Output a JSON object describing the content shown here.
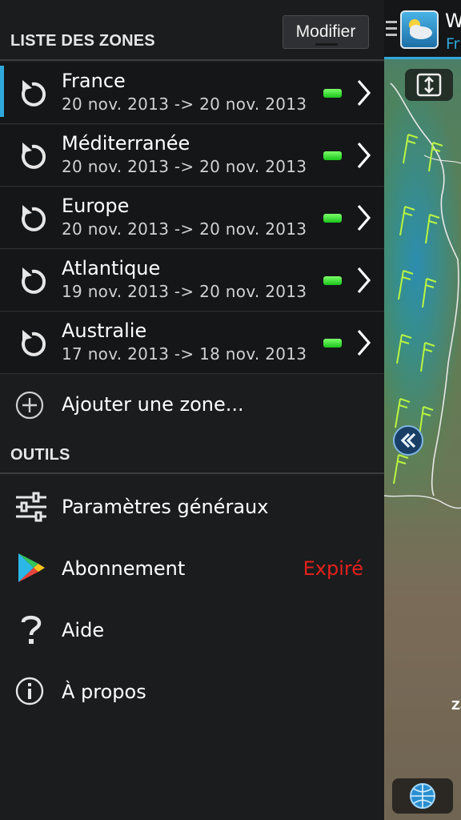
{
  "header": {
    "zones_title": "LISTE DES ZONES",
    "edit_label": "Modifier",
    "app_title_fragment": "W",
    "app_subtitle_fragment": "Fr"
  },
  "zones": [
    {
      "name": "France",
      "dates": "20 nov. 2013 -> 20 nov. 2013",
      "active": true,
      "status": "up-to-date"
    },
    {
      "name": "Méditerranée",
      "dates": "20 nov. 2013 -> 20 nov. 2013",
      "active": false,
      "status": "up-to-date"
    },
    {
      "name": "Europe",
      "dates": "20 nov. 2013 -> 20 nov. 2013",
      "active": false,
      "status": "up-to-date"
    },
    {
      "name": "Atlantique",
      "dates": "19 nov. 2013 -> 20 nov. 2013",
      "active": false,
      "status": "up-to-date"
    },
    {
      "name": "Australie",
      "dates": "17 nov. 2013 -> 18 nov. 2013",
      "active": false,
      "status": "up-to-date"
    }
  ],
  "add_zone_label": "Ajouter une zone...",
  "tools": {
    "title": "OUTILS",
    "items": [
      {
        "label": "Paramètres généraux",
        "icon": "sliders-icon"
      },
      {
        "label": "Abonnement",
        "icon": "play-store-icon",
        "badge": "Expiré"
      },
      {
        "label": "Aide",
        "icon": "question-icon"
      },
      {
        "label": "À propos",
        "icon": "info-icon"
      }
    ]
  },
  "map": {
    "label_fragment": "Za"
  },
  "colors": {
    "accent": "#2fa8dc",
    "status_ok": "#19c41b",
    "expired": "#e3211c",
    "drawer_bg": "#1b1c1e"
  }
}
